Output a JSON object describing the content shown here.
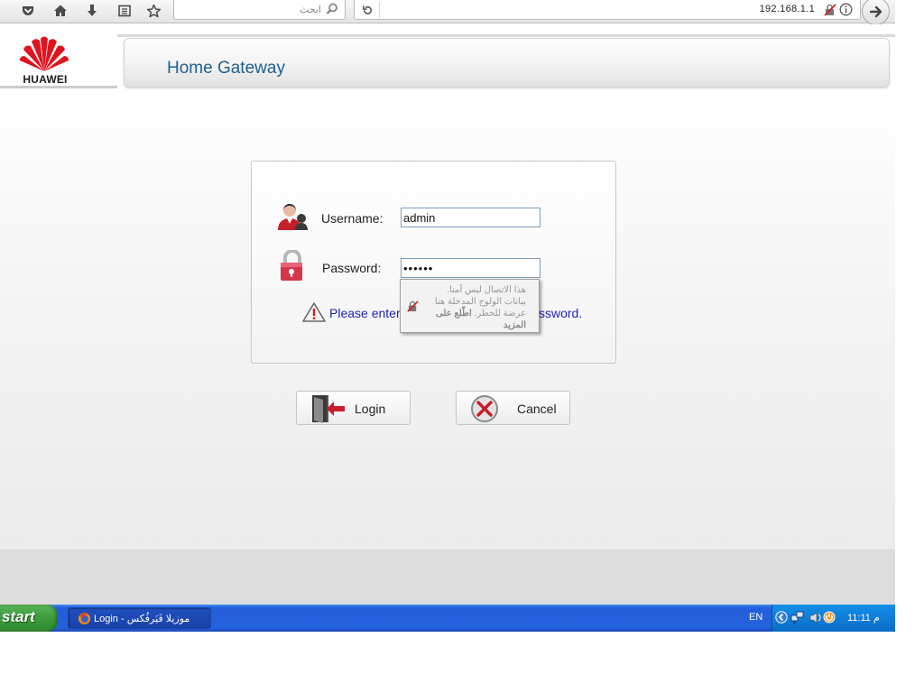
{
  "browser": {
    "search_placeholder": "ابحث",
    "url": "192.168.1.1"
  },
  "header": {
    "logo_text": "HUAWEI",
    "title": "Home Gateway"
  },
  "login": {
    "username_label": "Username:",
    "username_value": "admin",
    "password_label": "Password:",
    "password_value": "••••••",
    "warning_text_left": "Please enter",
    "warning_text_right": "ssword."
  },
  "tooltip": {
    "line1": "هذا الاتصال ليس آمنا.",
    "line2": "بيانات الولوج المدخلة هنا",
    "line3": "عرضة للخطر.",
    "learn_more": "اطّلع على المزيد"
  },
  "buttons": {
    "login_label": "Login",
    "cancel_label": "Cancel"
  },
  "taskbar": {
    "start_label": "start",
    "task_label": "Login - موزيلا فَيَرفُكس",
    "language": "EN",
    "clock": "11:11 م"
  },
  "colors": {
    "header_title": "#1f5f92",
    "warning_text": "#2222bb",
    "taskbar_blue": "#245edb",
    "start_green": "#3c9a3c",
    "huawei_red": "#e0141e"
  }
}
